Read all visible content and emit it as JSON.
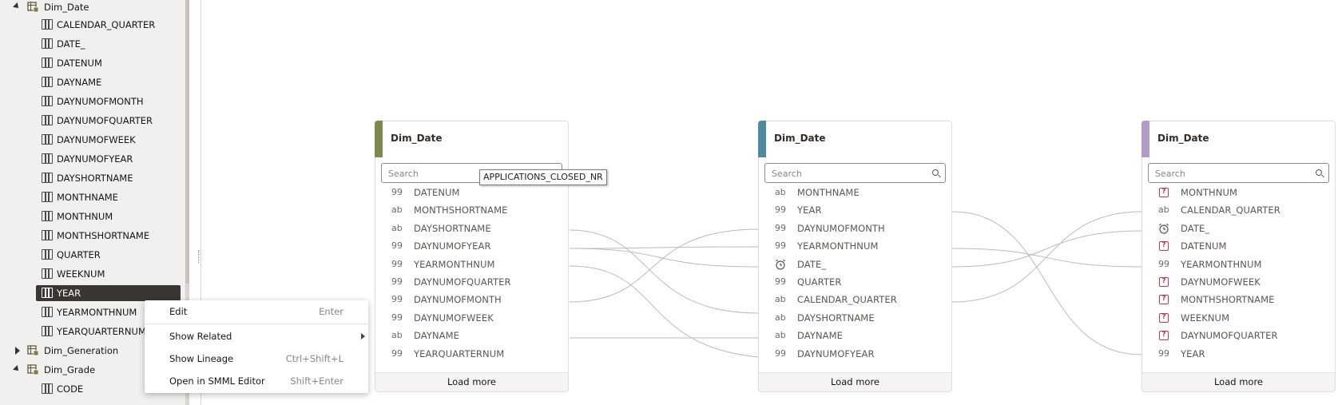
{
  "tree": {
    "nodes": [
      {
        "kind": "table",
        "label": "Dim_Date",
        "expanded": true
      },
      {
        "kind": "column",
        "label": "CALENDAR_QUARTER"
      },
      {
        "kind": "column",
        "label": "DATE_"
      },
      {
        "kind": "column",
        "label": "DATENUM"
      },
      {
        "kind": "column",
        "label": "DAYNAME"
      },
      {
        "kind": "column",
        "label": "DAYNUMOFMONTH"
      },
      {
        "kind": "column",
        "label": "DAYNUMOFQUARTER"
      },
      {
        "kind": "column",
        "label": "DAYNUMOFWEEK"
      },
      {
        "kind": "column",
        "label": "DAYNUMOFYEAR"
      },
      {
        "kind": "column",
        "label": "DAYSHORTNAME"
      },
      {
        "kind": "column",
        "label": "MONTHNAME"
      },
      {
        "kind": "column",
        "label": "MONTHNUM"
      },
      {
        "kind": "column",
        "label": "MONTHSHORTNAME"
      },
      {
        "kind": "column",
        "label": "QUARTER"
      },
      {
        "kind": "column",
        "label": "WEEKNUM"
      },
      {
        "kind": "column",
        "label": "YEAR",
        "selected": true
      },
      {
        "kind": "column",
        "label": "YEARMONTHNUM"
      },
      {
        "kind": "column",
        "label": "YEARQUARTERNUM"
      },
      {
        "kind": "table",
        "label": "Dim_Generation",
        "expanded": false
      },
      {
        "kind": "table",
        "label": "Dim_Grade",
        "expanded": true
      },
      {
        "kind": "column",
        "label": "CODE"
      }
    ]
  },
  "context_menu": {
    "items": [
      {
        "label": "Edit",
        "shortcut": "Enter"
      },
      {
        "label": "Show Related",
        "shortcut": "",
        "submenu": true
      },
      {
        "label": "Show Lineage",
        "shortcut": "Ctrl+Shift+L"
      },
      {
        "label": "Open in SMML Editor",
        "shortcut": "Shift+Enter"
      }
    ]
  },
  "tooltip": "APPLICATIONS_CLOSED_NR",
  "cards": [
    {
      "title": "Dim_Date",
      "accent": "#7d8a4c",
      "search_placeholder": "Search",
      "load_more": "Load more",
      "fields": [
        {
          "type": "99",
          "name": "DATENUM"
        },
        {
          "type": "ab",
          "name": "MONTHSHORTNAME"
        },
        {
          "type": "ab",
          "name": "DAYSHORTNAME"
        },
        {
          "type": "99",
          "name": "DAYNUMOFYEAR"
        },
        {
          "type": "99",
          "name": "YEARMONTHNUM"
        },
        {
          "type": "99",
          "name": "DAYNUMOFQUARTER"
        },
        {
          "type": "99",
          "name": "DAYNUMOFMONTH"
        },
        {
          "type": "99",
          "name": "DAYNUMOFWEEK"
        },
        {
          "type": "ab",
          "name": "DAYNAME"
        },
        {
          "type": "99",
          "name": "YEARQUARTERNUM"
        }
      ]
    },
    {
      "title": "Dim_Date",
      "accent": "#4f8aa0",
      "search_placeholder": "Search",
      "load_more": "Load more",
      "fields": [
        {
          "type": "ab",
          "name": "MONTHNAME"
        },
        {
          "type": "99",
          "name": "YEAR"
        },
        {
          "type": "99",
          "name": "DAYNUMOFMONTH"
        },
        {
          "type": "99",
          "name": "YEARMONTHNUM"
        },
        {
          "type": "date",
          "name": "DATE_"
        },
        {
          "type": "99",
          "name": "QUARTER"
        },
        {
          "type": "ab",
          "name": "CALENDAR_QUARTER"
        },
        {
          "type": "ab",
          "name": "DAYSHORTNAME"
        },
        {
          "type": "ab",
          "name": "DAYNAME"
        },
        {
          "type": "99",
          "name": "DAYNUMOFYEAR"
        }
      ]
    },
    {
      "title": "Dim_Date",
      "accent": "#b29acb",
      "search_placeholder": "Search",
      "load_more": "Load more",
      "fields": [
        {
          "type": "unknown",
          "name": "MONTHNUM"
        },
        {
          "type": "ab",
          "name": "CALENDAR_QUARTER"
        },
        {
          "type": "date",
          "name": "DATE_"
        },
        {
          "type": "unknown",
          "name": "DATENUM"
        },
        {
          "type": "99",
          "name": "YEARMONTHNUM"
        },
        {
          "type": "unknown",
          "name": "DAYNUMOFWEEK"
        },
        {
          "type": "unknown",
          "name": "MONTHSHORTNAME"
        },
        {
          "type": "unknown",
          "name": "WEEKNUM"
        },
        {
          "type": "unknown",
          "name": "DAYNUMOFQUARTER"
        },
        {
          "type": "99",
          "name": "YEAR"
        }
      ]
    }
  ]
}
